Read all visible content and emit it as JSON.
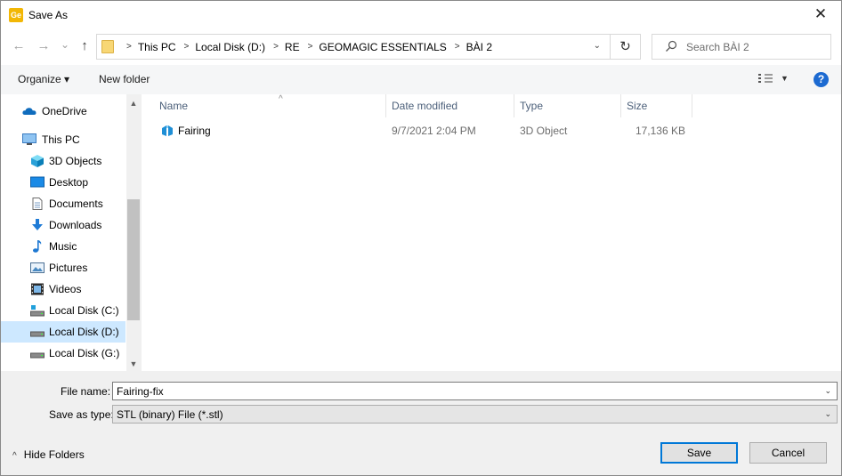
{
  "window": {
    "title": "Save As",
    "app_icon_text": "Ge",
    "close_glyph": "✕"
  },
  "nav": {
    "back_glyph": "←",
    "forward_glyph": "→",
    "history_glyph": "⌄",
    "up_glyph": "↑",
    "breadcrumb": [
      "This PC",
      "Local Disk (D:)",
      "RE",
      "GEOMAGIC ESSENTIALS",
      "BÀI 2"
    ],
    "refresh_glyph": "↻",
    "search_placeholder": "Search BÀI 2"
  },
  "toolbar": {
    "organize_label": "Organize ▾",
    "new_folder_label": "New folder",
    "help_glyph": "?"
  },
  "sidebar": {
    "items": [
      {
        "label": "OneDrive",
        "icon": "onedrive-icon"
      },
      {
        "label": "This PC",
        "icon": "computer-icon"
      },
      {
        "label": "3D Objects",
        "icon": "3d-objects-icon"
      },
      {
        "label": "Desktop",
        "icon": "desktop-icon"
      },
      {
        "label": "Documents",
        "icon": "documents-icon"
      },
      {
        "label": "Downloads",
        "icon": "downloads-icon"
      },
      {
        "label": "Music",
        "icon": "music-icon"
      },
      {
        "label": "Pictures",
        "icon": "pictures-icon"
      },
      {
        "label": "Videos",
        "icon": "videos-icon"
      },
      {
        "label": "Local Disk (C:)",
        "icon": "drive-icon"
      },
      {
        "label": "Local Disk (D:)",
        "icon": "drive-icon",
        "selected": true
      },
      {
        "label": "Local Disk (G:)",
        "icon": "drive-icon"
      }
    ]
  },
  "file_list": {
    "columns": [
      "Name",
      "Date modified",
      "Type",
      "Size"
    ],
    "sort_glyph": "^",
    "rows": [
      {
        "name": "Fairing",
        "date_modified": "9/7/2021 2:04 PM",
        "type": "3D Object",
        "size": "17,136 KB",
        "icon": "3d-object-file-icon"
      }
    ]
  },
  "form": {
    "file_name_label": "File name:",
    "file_name_value": "Fairing-fix",
    "save_as_type_label": "Save as type:",
    "save_as_type_value": "STL (binary) File (*.stl)",
    "dropdown_glyph": "⌄"
  },
  "footer": {
    "hide_folders_label": "Hide Folders",
    "hide_folders_glyph": "^",
    "save_label": "Save",
    "cancel_label": "Cancel"
  },
  "colors": {
    "accent": "#0078d7",
    "selected_bg": "#cde8ff",
    "header_text": "#4c607a",
    "help_icon": "#1c6ad1",
    "folder": "#f8d775"
  }
}
